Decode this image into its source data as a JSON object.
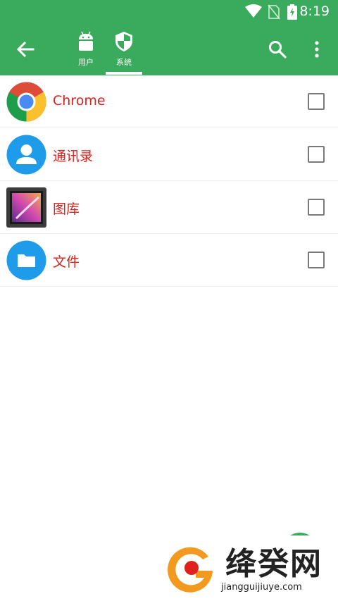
{
  "status_bar": {
    "time": "8:19",
    "icons": [
      "wifi-icon",
      "no-sim-icon",
      "battery-charging-icon"
    ]
  },
  "toolbar": {
    "back_icon": "arrow-back-icon",
    "tabs": [
      {
        "label": "用户",
        "icon": "android-icon",
        "selected": false
      },
      {
        "label": "系统",
        "icon": "shield-icon",
        "selected": true
      }
    ],
    "search_icon": "search-icon",
    "more_icon": "more-vert-icon"
  },
  "apps": [
    {
      "name": "Chrome",
      "icon": "chrome-icon",
      "checked": false
    },
    {
      "name": "通讯录",
      "icon": "contacts-icon",
      "checked": false
    },
    {
      "name": "图库",
      "icon": "gallery-icon",
      "checked": false
    },
    {
      "name": "文件",
      "icon": "files-icon",
      "checked": false
    }
  ],
  "watermark": {
    "brand": "绛癸网",
    "url": "jiangguijiuye.com"
  },
  "colors": {
    "appbar": "#3aaa5c",
    "app_name": "#e0201c"
  }
}
